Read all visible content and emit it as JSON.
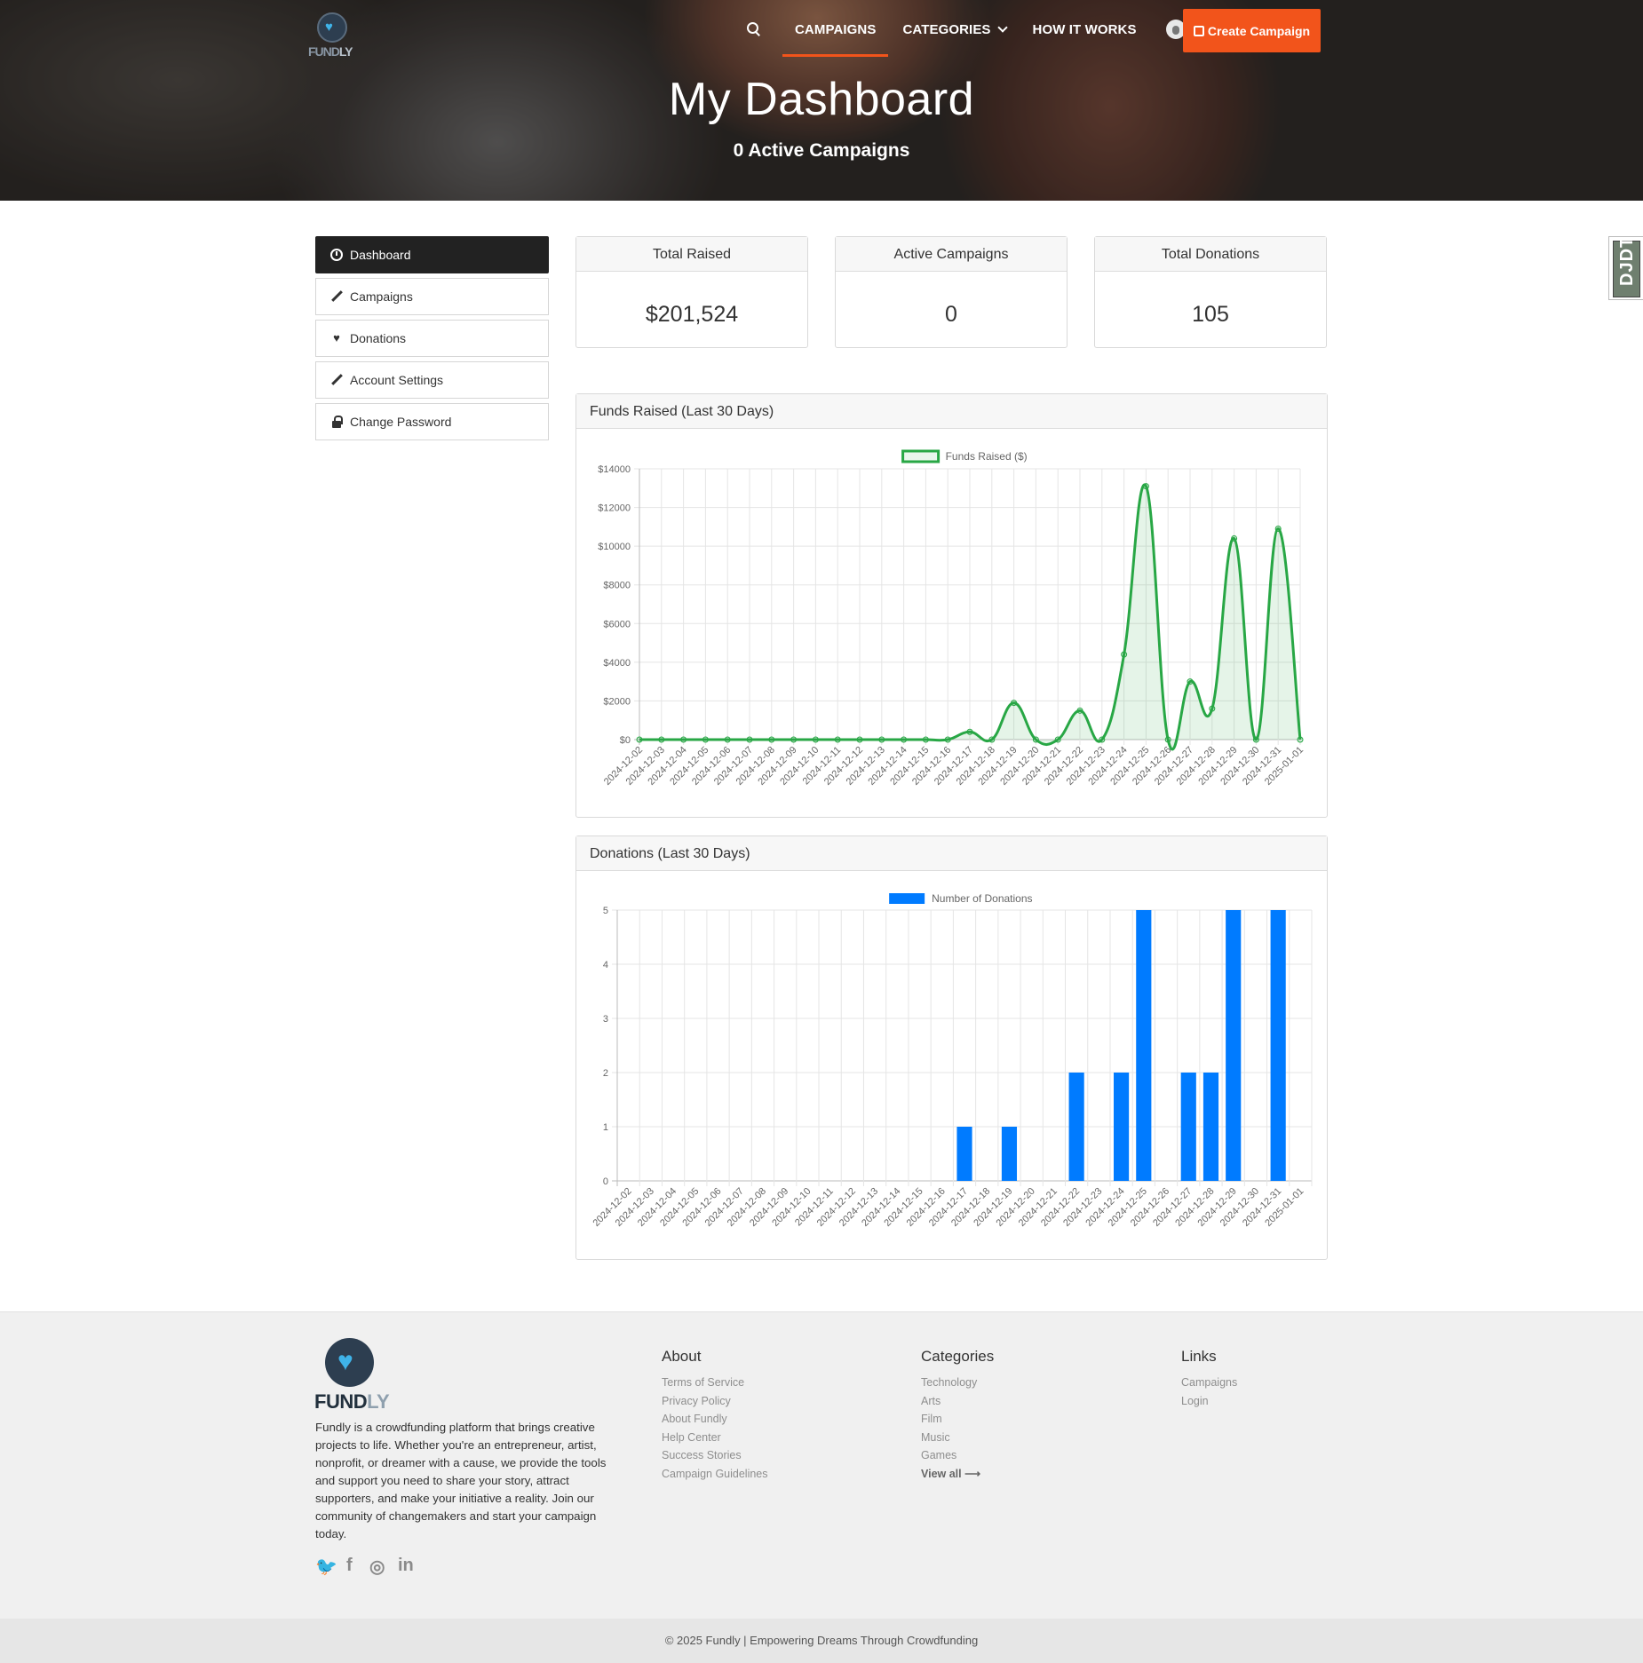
{
  "brand": {
    "name_part1": "FUND",
    "name_part2": "LY"
  },
  "nav": {
    "items": [
      "CAMPAIGNS",
      "CATEGORIES",
      "HOW IT WORKS"
    ],
    "create_label": "Create Campaign",
    "accent_color": "#f2541b"
  },
  "hero": {
    "title": "My Dashboard",
    "subtitle": "0 Active Campaigns"
  },
  "sidebar": {
    "items": [
      {
        "label": "Dashboard",
        "icon": "dashboard-icon"
      },
      {
        "label": "Campaigns",
        "icon": "pencil-icon"
      },
      {
        "label": "Donations",
        "icon": "heart-icon"
      },
      {
        "label": "Account Settings",
        "icon": "pencil-icon"
      },
      {
        "label": "Change Password",
        "icon": "lock-icon"
      }
    ]
  },
  "stats": [
    {
      "label": "Total Raised",
      "value": "$201,524"
    },
    {
      "label": "Active Campaigns",
      "value": "0"
    },
    {
      "label": "Total Donations",
      "value": "105"
    }
  ],
  "charts": {
    "funds_title": "Funds Raised (Last 30 Days)",
    "donations_title": "Donations (Last 30 Days)"
  },
  "chart_data": [
    {
      "type": "line",
      "title": "Funds Raised (Last 30 Days)",
      "color": "#28a745",
      "x": [
        "2024-12-02",
        "2024-12-03",
        "2024-12-04",
        "2024-12-05",
        "2024-12-06",
        "2024-12-07",
        "2024-12-08",
        "2024-12-09",
        "2024-12-10",
        "2024-12-11",
        "2024-12-12",
        "2024-12-13",
        "2024-12-14",
        "2024-12-15",
        "2024-12-16",
        "2024-12-17",
        "2024-12-18",
        "2024-12-19",
        "2024-12-20",
        "2024-12-21",
        "2024-12-22",
        "2024-12-23",
        "2024-12-24",
        "2024-12-25",
        "2024-12-26",
        "2024-12-27",
        "2024-12-28",
        "2024-12-29",
        "2024-12-30",
        "2024-12-31",
        "2025-01-01"
      ],
      "series": [
        {
          "name": "Funds Raised ($)",
          "values": [
            0,
            0,
            0,
            0,
            0,
            0,
            0,
            0,
            0,
            0,
            0,
            0,
            0,
            0,
            0,
            400,
            0,
            1900,
            0,
            0,
            1500,
            0,
            4400,
            13100,
            0,
            3000,
            1600,
            10400,
            0,
            10900,
            0
          ]
        }
      ],
      "ylim": [
        0,
        14000
      ],
      "yticks": [
        "$0",
        "$2000",
        "$4000",
        "$6000",
        "$8000",
        "$10000",
        "$12000",
        "$14000"
      ],
      "legend": "top"
    },
    {
      "type": "bar",
      "title": "Donations (Last 30 Days)",
      "color": "#007bff",
      "x": [
        "2024-12-02",
        "2024-12-03",
        "2024-12-04",
        "2024-12-05",
        "2024-12-06",
        "2024-12-07",
        "2024-12-08",
        "2024-12-09",
        "2024-12-10",
        "2024-12-11",
        "2024-12-12",
        "2024-12-13",
        "2024-12-14",
        "2024-12-15",
        "2024-12-16",
        "2024-12-17",
        "2024-12-18",
        "2024-12-19",
        "2024-12-20",
        "2024-12-21",
        "2024-12-22",
        "2024-12-23",
        "2024-12-24",
        "2024-12-25",
        "2024-12-26",
        "2024-12-27",
        "2024-12-28",
        "2024-12-29",
        "2024-12-30",
        "2024-12-31",
        "2025-01-01"
      ],
      "series": [
        {
          "name": "Number of Donations",
          "values": [
            0,
            0,
            0,
            0,
            0,
            0,
            0,
            0,
            0,
            0,
            0,
            0,
            0,
            0,
            0,
            1,
            0,
            1,
            0,
            0,
            2,
            0,
            2,
            5,
            0,
            2,
            2,
            5,
            0,
            5,
            0
          ]
        }
      ],
      "ylim": [
        0,
        5
      ],
      "yticks": [
        "0",
        "1",
        "2",
        "3",
        "4",
        "5"
      ],
      "legend": "top"
    }
  ],
  "djdt": "DJDT",
  "footer": {
    "description": "Fundly is a crowdfunding platform that brings creative projects to life. Whether you're an entrepreneur, artist, nonprofit, or dreamer with a cause, we provide the tools and support you need to share your story, attract supporters, and make your initiative a reality. Join our community of changemakers and start your campaign today.",
    "social": [
      {
        "name": "twitter-icon",
        "glyph": "🐦"
      },
      {
        "name": "facebook-icon",
        "glyph": "f"
      },
      {
        "name": "instagram-icon",
        "glyph": "◎"
      },
      {
        "name": "linkedin-icon",
        "glyph": "in"
      }
    ],
    "about": {
      "title": "About",
      "links": [
        "Terms of Service",
        "Privacy Policy",
        "About Fundly",
        "Help Center",
        "Success Stories",
        "Campaign Guidelines"
      ]
    },
    "categories": {
      "title": "Categories",
      "links": [
        "Technology",
        "Arts",
        "Film",
        "Music",
        "Games"
      ],
      "view_all": "View all"
    },
    "links": {
      "title": "Links",
      "links": [
        "Campaigns",
        "Login"
      ]
    },
    "copyright": "© 2025 Fundly | Empowering Dreams Through Crowdfunding"
  }
}
